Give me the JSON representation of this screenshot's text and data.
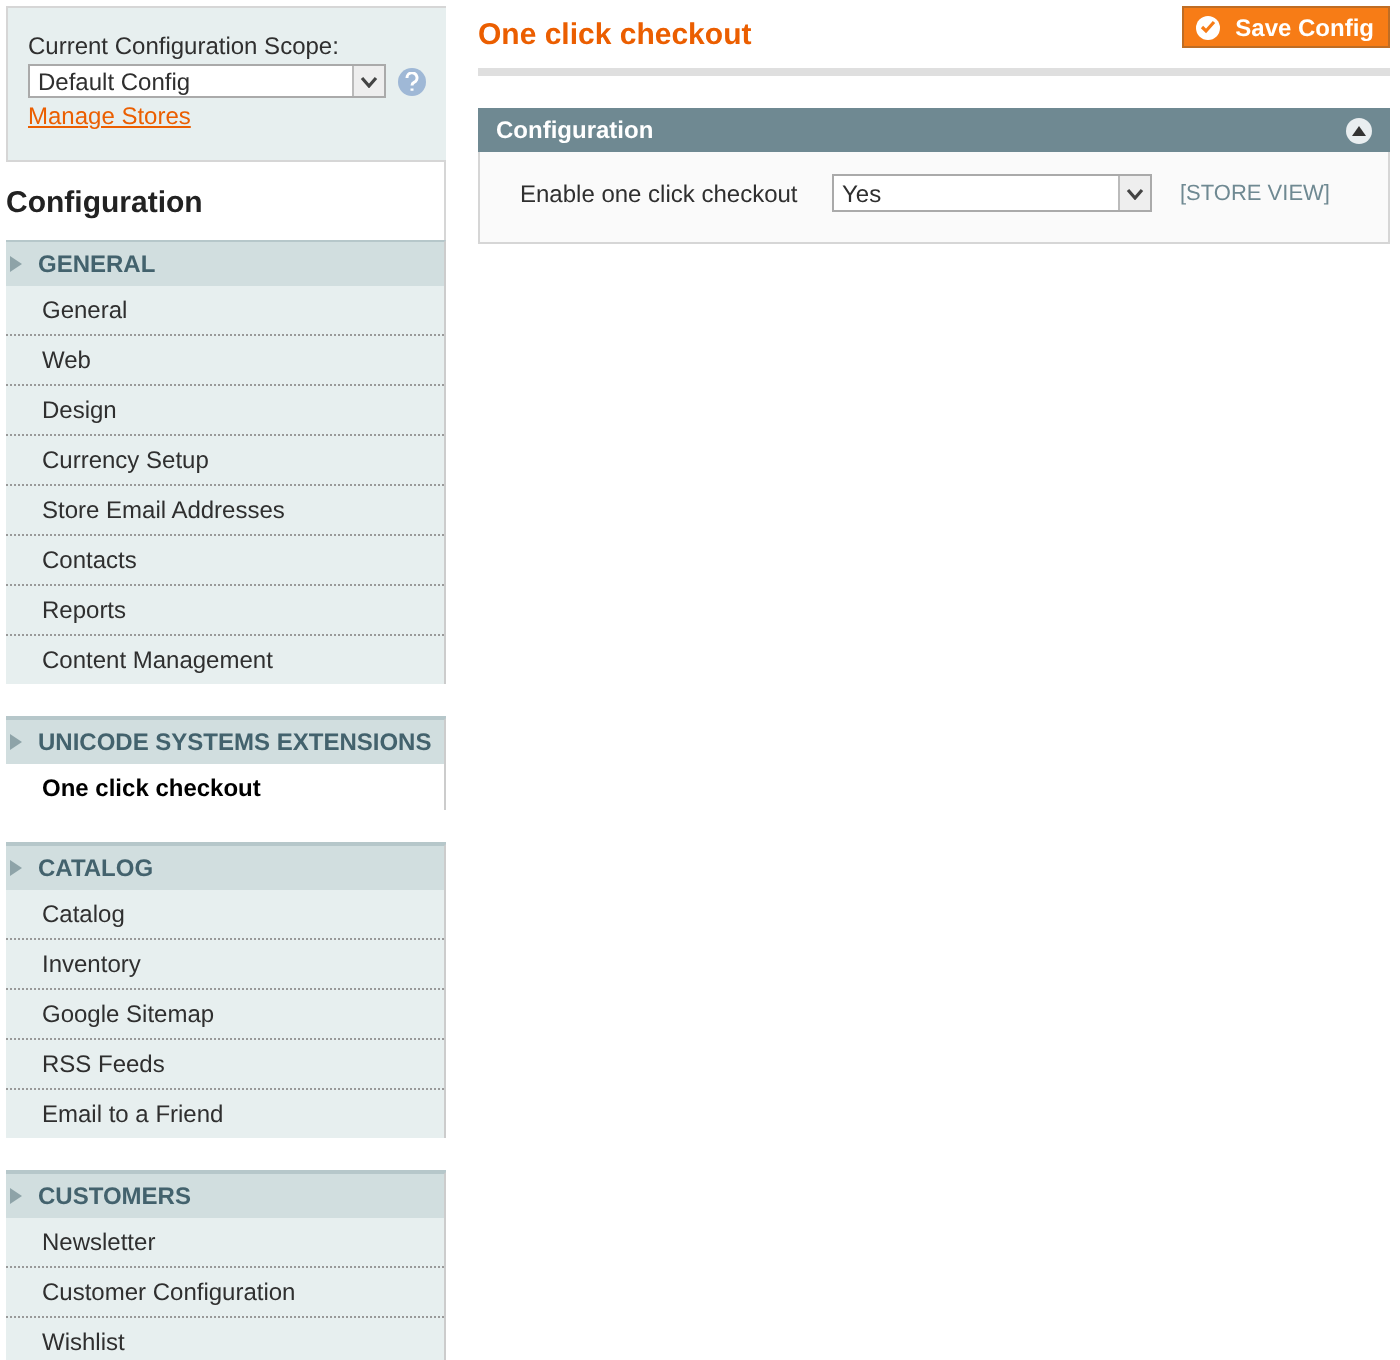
{
  "scope": {
    "label": "Current Configuration Scope:",
    "value": "Default Config",
    "link": "Manage Stores"
  },
  "sidebar": {
    "title": "Configuration",
    "groups": [
      {
        "title": "GENERAL",
        "items": [
          {
            "label": "General",
            "selected": false
          },
          {
            "label": "Web",
            "selected": false
          },
          {
            "label": "Design",
            "selected": false
          },
          {
            "label": "Currency Setup",
            "selected": false
          },
          {
            "label": "Store Email Addresses",
            "selected": false
          },
          {
            "label": "Contacts",
            "selected": false
          },
          {
            "label": "Reports",
            "selected": false
          },
          {
            "label": "Content Management",
            "selected": false
          }
        ]
      },
      {
        "title": "UNICODE SYSTEMS EXTENSIONS",
        "items": [
          {
            "label": "One click checkout",
            "selected": true
          }
        ]
      },
      {
        "title": "CATALOG",
        "items": [
          {
            "label": "Catalog",
            "selected": false
          },
          {
            "label": "Inventory",
            "selected": false
          },
          {
            "label": "Google Sitemap",
            "selected": false
          },
          {
            "label": "RSS Feeds",
            "selected": false
          },
          {
            "label": "Email to a Friend",
            "selected": false
          }
        ]
      },
      {
        "title": "CUSTOMERS",
        "items": [
          {
            "label": "Newsletter",
            "selected": false
          },
          {
            "label": "Customer Configuration",
            "selected": false
          },
          {
            "label": "Wishlist",
            "selected": false
          }
        ]
      }
    ]
  },
  "page": {
    "title": "One click checkout",
    "save_button": "Save Config"
  },
  "section": {
    "title": "Configuration",
    "expanded": true,
    "fields": [
      {
        "label": "Enable one click checkout",
        "value": "Yes",
        "scope": "[STORE VIEW]"
      }
    ]
  }
}
